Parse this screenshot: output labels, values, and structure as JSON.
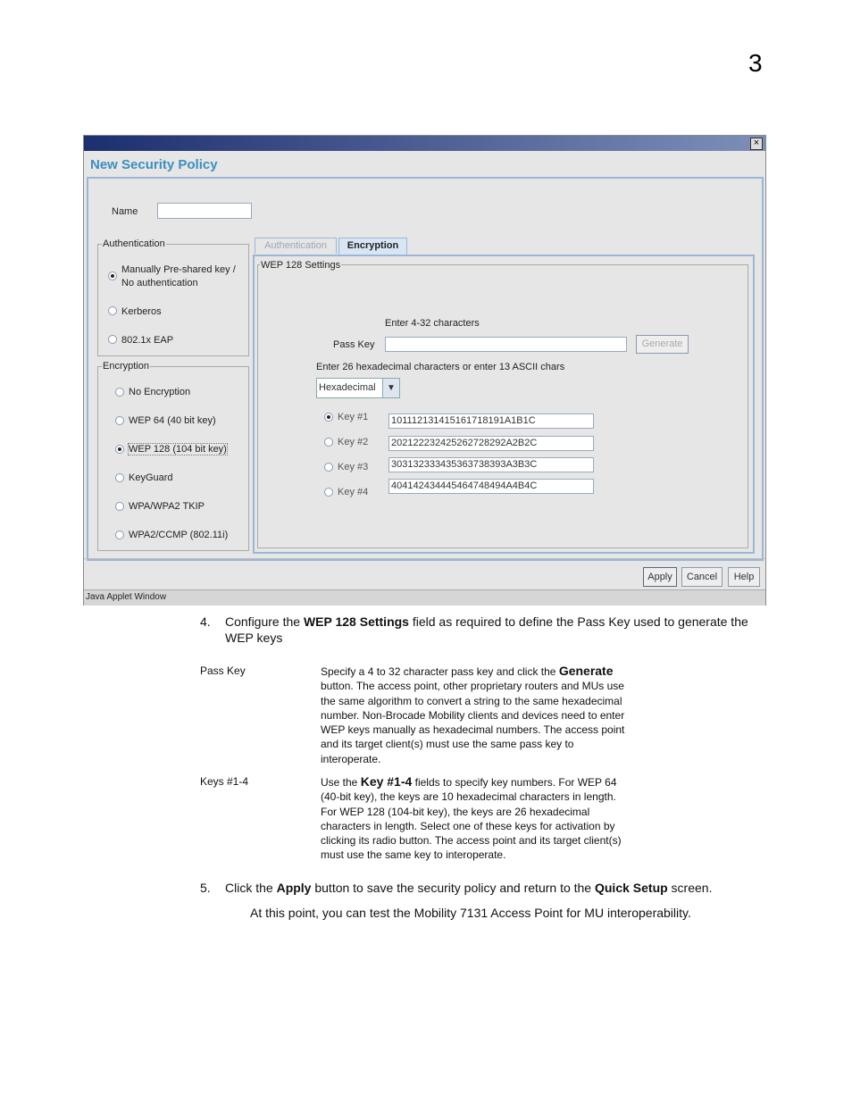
{
  "chapter_number": "3",
  "window": {
    "title": "New Security Policy",
    "name_label": "Name",
    "name_value": "",
    "authentication": {
      "legend": "Authentication",
      "options": [
        "Manually Pre-shared key / No authentication",
        "Kerberos",
        "802.1x EAP"
      ],
      "option0_line1": "Manually Pre-shared key /",
      "option0_line2": "No authentication",
      "selected": 0
    },
    "encryption": {
      "legend": "Encryption",
      "options": [
        "No Encryption",
        "WEP 64 (40 bit key)",
        "WEP 128 (104 bit key)",
        "KeyGuard",
        "WPA/WPA2 TKIP",
        "WPA2/CCMP (802.11i)"
      ],
      "selected": 2
    },
    "tabs": [
      {
        "label": "Authentication",
        "active": false
      },
      {
        "label": "Encryption",
        "active": true
      }
    ],
    "wep": {
      "legend": "WEP  128 Settings",
      "passkey_hint": "Enter 4-32 characters",
      "passkey_label": "Pass Key",
      "passkey_value": "",
      "generate": "Generate",
      "hex_hint": "Enter 26 hexadecimal characters or enter 13 ASCII chars",
      "format": "Hexadecimal",
      "keys": [
        {
          "label": "Key #1",
          "value": "101112131415161718191A1B1C"
        },
        {
          "label": "Key #2",
          "value": "202122232425262728292A2B2C"
        },
        {
          "label": "Key #3",
          "value": "303132333435363738393A3B3C"
        },
        {
          "label": "Key #4",
          "value": "404142434445464748494A4B4C"
        }
      ],
      "selected_key": 0
    },
    "buttons": {
      "apply": "Apply",
      "cancel": "Cancel",
      "help": "Help"
    },
    "status": "Java Applet Window"
  },
  "doc": {
    "step4_num": "4.",
    "step4_a": "Configure the ",
    "step4_b": "WEP 128 Settings",
    "step4_c": " field as required to define the Pass Key used to generate the",
    "step4_d": "WEP keys",
    "passkey_term": "Pass Key",
    "passkey_desc_a": "Specify a 4 to 32 character pass key and click the ",
    "passkey_desc_b": "Generate",
    "passkey_desc_lines": [
      "button. The access point, other proprietary routers and MUs use",
      "the same algorithm to convert a string to the same hexadecimal",
      "number. Non-Brocade Mobility clients and devices need to enter",
      "WEP keys manually as hexadecimal numbers. The access point",
      "and its target client(s) must use the same pass key to",
      "interoperate."
    ],
    "keys_term": "Keys #1-4",
    "keys_desc_a": "Use the ",
    "keys_desc_b": "Key #1-4",
    "keys_desc_c": " fields to specify key numbers. For WEP 64",
    "keys_desc_lines": [
      "(40-bit key), the keys are 10 hexadecimal characters in length.",
      "For WEP 128 (104-bit key), the keys are 26 hexadecimal",
      "characters in length. Select one of these keys for activation by",
      "clicking its radio button. The access point and its target client(s)",
      "must use the same key to interoperate."
    ],
    "step5_num": "5.",
    "step5_a": "Click the ",
    "step5_b": "Apply",
    "step5_c": " button to save the security policy and return to the ",
    "step5_d": "Quick Setup",
    "step5_e": " screen.",
    "note": "At this point, you can test the Mobility 7131 Access Point for MU interoperability."
  }
}
